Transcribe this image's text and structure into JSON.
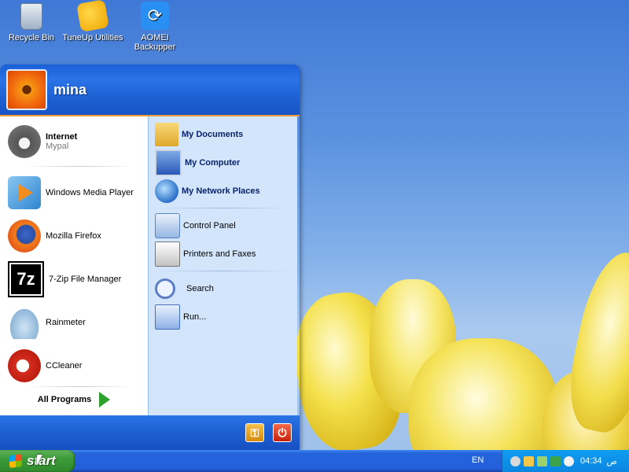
{
  "desktop": {
    "icons": [
      {
        "label": "Recycle Bin",
        "icon": "recycle-bin-icon"
      },
      {
        "label": "TuneUp Utilities",
        "icon": "tuneup-icon"
      },
      {
        "label": "AOMEI Backupper",
        "icon": "aomei-icon"
      }
    ]
  },
  "start_menu": {
    "user": "mina",
    "pinned": {
      "title": "Internet",
      "subtitle": "Mypal"
    },
    "recent": [
      {
        "label": "Windows Media Player"
      },
      {
        "label": "Mozilla Firefox"
      },
      {
        "label": "7-Zip File Manager",
        "glyph": "7z"
      },
      {
        "label": "Rainmeter"
      },
      {
        "label": "CCleaner"
      }
    ],
    "all_programs": "All Programs",
    "right_top": [
      {
        "label": "My Documents"
      },
      {
        "label": "My Computer"
      },
      {
        "label": "My Network Places"
      }
    ],
    "right_middle": [
      {
        "label": "Control Panel"
      },
      {
        "label": "Printers and Faxes"
      }
    ],
    "right_bottom": [
      {
        "label": "Search"
      },
      {
        "label": "Run..."
      }
    ]
  },
  "taskbar": {
    "start_label": "start",
    "language": "EN",
    "clock": "04:34",
    "ampm": "ص"
  }
}
